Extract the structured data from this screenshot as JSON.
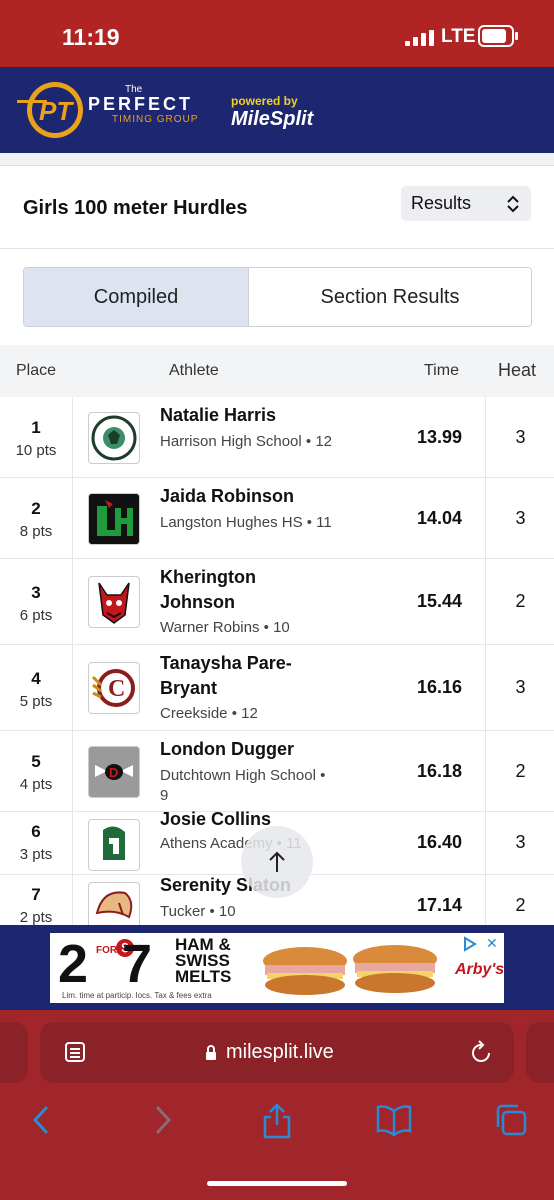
{
  "status": {
    "time": "11:19",
    "network": "LTE"
  },
  "header": {
    "logo_initials": "PT",
    "logo_the": "The",
    "logo_perfect": "PERFECT",
    "logo_timing": "TIMING GROUP",
    "powered_by": "powered by",
    "brand": "MileSplit"
  },
  "event": {
    "title": "Girls 100 meter Hurdles",
    "view_select": "Results"
  },
  "tabs": [
    {
      "label": "Compiled"
    },
    {
      "label": "Section Results"
    }
  ],
  "table": {
    "headers": {
      "place": "Place",
      "athlete": "Athlete",
      "time": "Time",
      "heat": "Heat"
    },
    "rows": [
      {
        "place": "1",
        "pts": "10 pts",
        "name": "Natalie Harris",
        "school": "Harrison High School • 12",
        "time": "13.99",
        "heat": "3",
        "logo": "harrison-hoyas-logo"
      },
      {
        "place": "2",
        "pts": "8 pts",
        "name": "Jaida Robinson",
        "school": "Langston Hughes HS • 11",
        "time": "14.04",
        "heat": "3",
        "logo": "langston-hughes-logo"
      },
      {
        "place": "3",
        "pts": "6 pts",
        "name": "Kherington Johnson",
        "school": "Warner Robins • 10",
        "time": "15.44",
        "heat": "2",
        "logo": "warner-robins-demon-logo"
      },
      {
        "place": "4",
        "pts": "5 pts",
        "name": "Tanaysha Pare-Bryant",
        "school": "Creekside • 12",
        "time": "16.16",
        "heat": "3",
        "logo": "creekside-c-logo"
      },
      {
        "place": "5",
        "pts": "4 pts",
        "name": "London Dugger",
        "school": "Dutchtown High School • 9",
        "time": "16.18",
        "heat": "2",
        "logo": "dutchtown-d-logo"
      },
      {
        "place": "6",
        "pts": "3 pts",
        "name": "Josie Collins",
        "school": "Athens Academy • 11",
        "time": "16.40",
        "heat": "3",
        "logo": "athens-spartan-logo"
      },
      {
        "place": "7",
        "pts": "2 pts",
        "name": "Serenity Slaton",
        "school": "Tucker • 10",
        "time": "17.14",
        "heat": "2",
        "logo": "tucker-tiger-logo"
      }
    ]
  },
  "ad": {
    "count": "2",
    "for": "FOR",
    "price": "7",
    "dollar": "$",
    "line1": "HAM &",
    "line2": "SWISS",
    "line3": "MELTS",
    "fine_print": "Lim. time at particip. locs. Tax & fees extra",
    "brand": "Arby's"
  },
  "browser": {
    "url": "milesplit.live"
  },
  "colors": {
    "status_bar": "#b02424",
    "header": "#1d2670",
    "browser_chrome": "#a0262b",
    "active_tab": "#dde3ef"
  }
}
